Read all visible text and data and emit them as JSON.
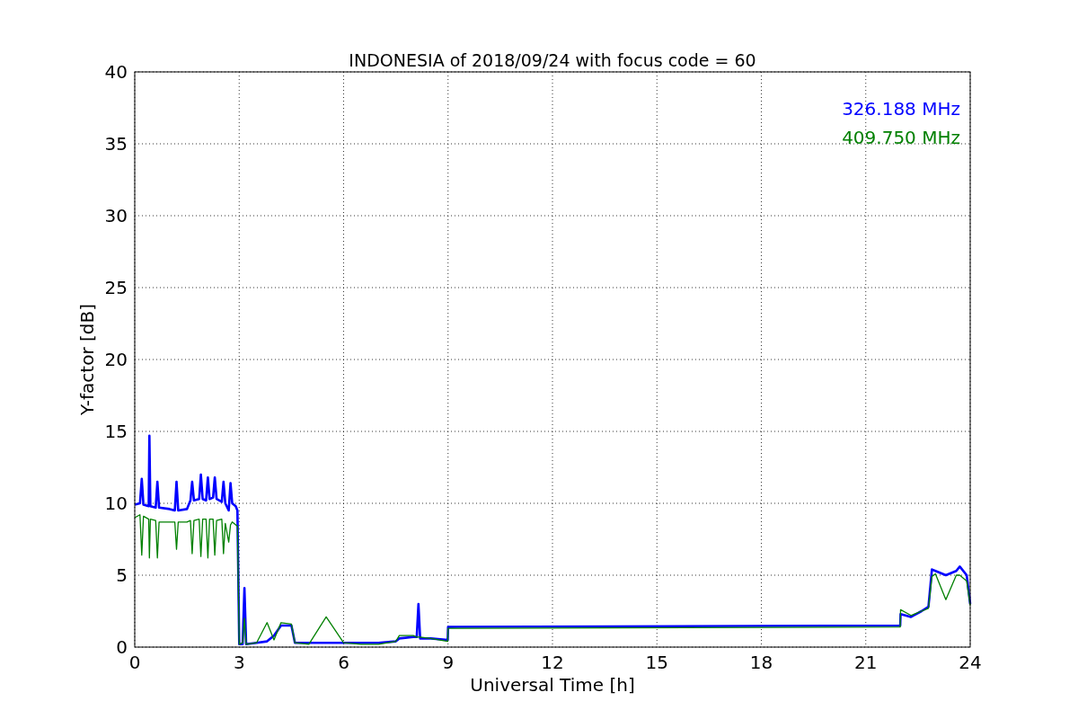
{
  "figure": {
    "chart_data": {
      "type": "line",
      "title": "INDONESIA of 2018/09/24 with focus code = 60",
      "xlabel": "Universal Time [h]",
      "ylabel": "Y-factor [dB]",
      "x": [
        0,
        0.15,
        0.2,
        0.25,
        0.4,
        0.42,
        0.45,
        0.6,
        0.65,
        0.7,
        1.0,
        1.15,
        1.2,
        1.25,
        1.5,
        1.6,
        1.65,
        1.7,
        1.85,
        1.9,
        1.95,
        2.05,
        2.1,
        2.15,
        2.25,
        2.3,
        2.35,
        2.5,
        2.55,
        2.6,
        2.7,
        2.75,
        2.8,
        2.9,
        2.95,
        3.0,
        3.1,
        3.15,
        3.2,
        3.5,
        3.8,
        4.0,
        4.2,
        4.5,
        4.6,
        5.0,
        5.5,
        6.0,
        6.5,
        7.0,
        7.5,
        7.6,
        8.0,
        8.1,
        8.15,
        8.2,
        8.5,
        8.99,
        9.0,
        21.99,
        22.0,
        22.3,
        22.6,
        22.8,
        22.9,
        23.0,
        23.3,
        23.6,
        23.7,
        23.9,
        24.0
      ],
      "series": [
        {
          "name": "326.188 MHz",
          "color": "#0000ff",
          "values": [
            9.9,
            10.0,
            11.7,
            9.9,
            9.8,
            14.7,
            9.8,
            9.7,
            11.5,
            9.7,
            9.6,
            9.5,
            11.5,
            9.5,
            9.6,
            10.2,
            11.5,
            10.2,
            10.3,
            12.0,
            10.3,
            10.2,
            11.8,
            10.3,
            10.4,
            11.8,
            10.3,
            10.1,
            11.5,
            10.0,
            9.5,
            11.4,
            10.0,
            9.8,
            9.5,
            0.2,
            0.2,
            4.1,
            0.2,
            0.3,
            0.4,
            0.8,
            1.5,
            1.5,
            0.3,
            0.3,
            0.3,
            0.3,
            0.3,
            0.3,
            0.4,
            0.6,
            0.7,
            0.7,
            3.0,
            0.6,
            0.6,
            0.5,
            1.4,
            1.5,
            2.3,
            2.1,
            2.5,
            2.8,
            5.4,
            5.3,
            5.0,
            5.3,
            5.6,
            5.0,
            3.0
          ]
        },
        {
          "name": "409.750 MHz",
          "color": "#008000",
          "values": [
            9.0,
            9.2,
            6.4,
            9.1,
            8.9,
            6.2,
            8.9,
            8.8,
            6.2,
            8.7,
            8.7,
            8.7,
            6.8,
            8.7,
            8.7,
            8.8,
            6.5,
            8.8,
            8.9,
            6.3,
            8.9,
            8.9,
            6.2,
            8.9,
            8.9,
            6.4,
            8.8,
            8.9,
            6.5,
            8.6,
            7.3,
            8.5,
            8.7,
            8.5,
            8.4,
            0.2,
            0.3,
            2.0,
            0.2,
            0.3,
            1.7,
            0.5,
            1.7,
            1.6,
            0.3,
            0.2,
            2.1,
            0.3,
            0.2,
            0.2,
            0.4,
            0.8,
            0.8,
            0.7,
            0.7,
            0.7,
            0.6,
            0.4,
            1.3,
            1.4,
            2.6,
            2.2,
            2.5,
            2.7,
            4.9,
            5.1,
            3.3,
            5.0,
            5.0,
            4.6,
            2.9
          ]
        }
      ],
      "grid": true,
      "xlim": [
        0,
        24
      ],
      "ylim": [
        0,
        40
      ],
      "xticks": [
        0,
        3,
        6,
        9,
        12,
        15,
        18,
        21,
        24
      ],
      "yticks": [
        0,
        5,
        10,
        15,
        20,
        25,
        30,
        35,
        40
      ]
    }
  }
}
